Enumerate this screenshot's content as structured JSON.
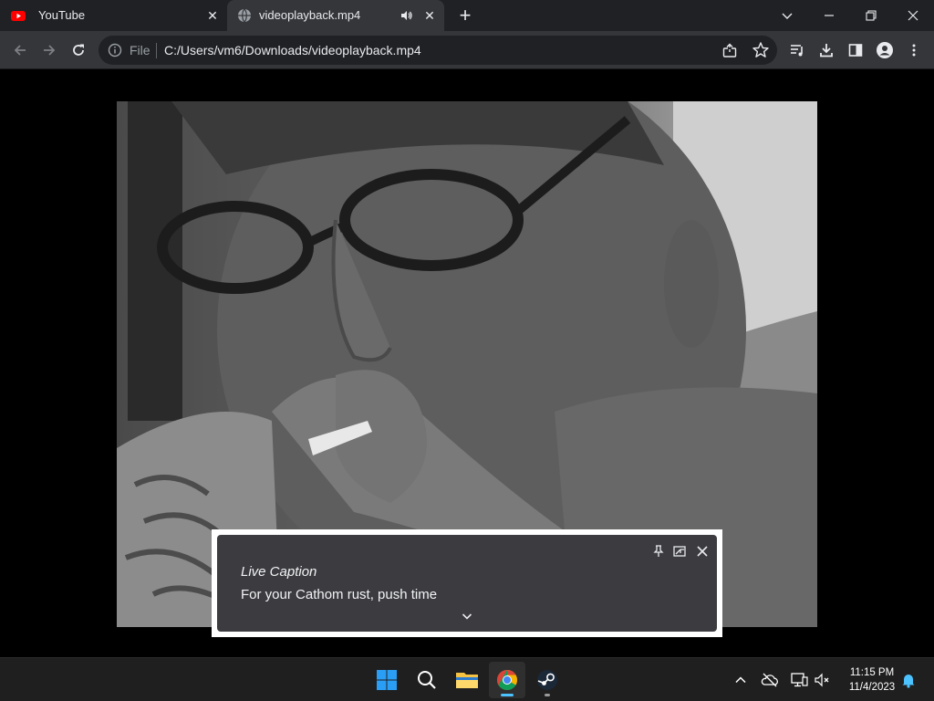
{
  "browser": {
    "tabs": [
      {
        "title": "YouTube",
        "active": false,
        "favicon": "youtube-icon"
      },
      {
        "title": "videoplayback.mp4",
        "active": true,
        "favicon": "globe-icon",
        "audio": true
      }
    ],
    "omnibox": {
      "scheme_label": "File",
      "url": "C:/Users/vm6/Downloads/videoplayback.mp4"
    }
  },
  "live_caption": {
    "title": "Live Caption",
    "text": "For your Cathom rust, push time"
  },
  "taskbar": {
    "apps": [
      "windows-start",
      "search",
      "file-explorer",
      "chrome",
      "steam"
    ],
    "clock": {
      "time": "11:15 PM",
      "date": "11/4/2023"
    }
  },
  "colors": {
    "tabstrip": "#202124",
    "toolbar": "#35363a",
    "accent": "#4cc2ff",
    "youtube_red": "#ff0000"
  }
}
